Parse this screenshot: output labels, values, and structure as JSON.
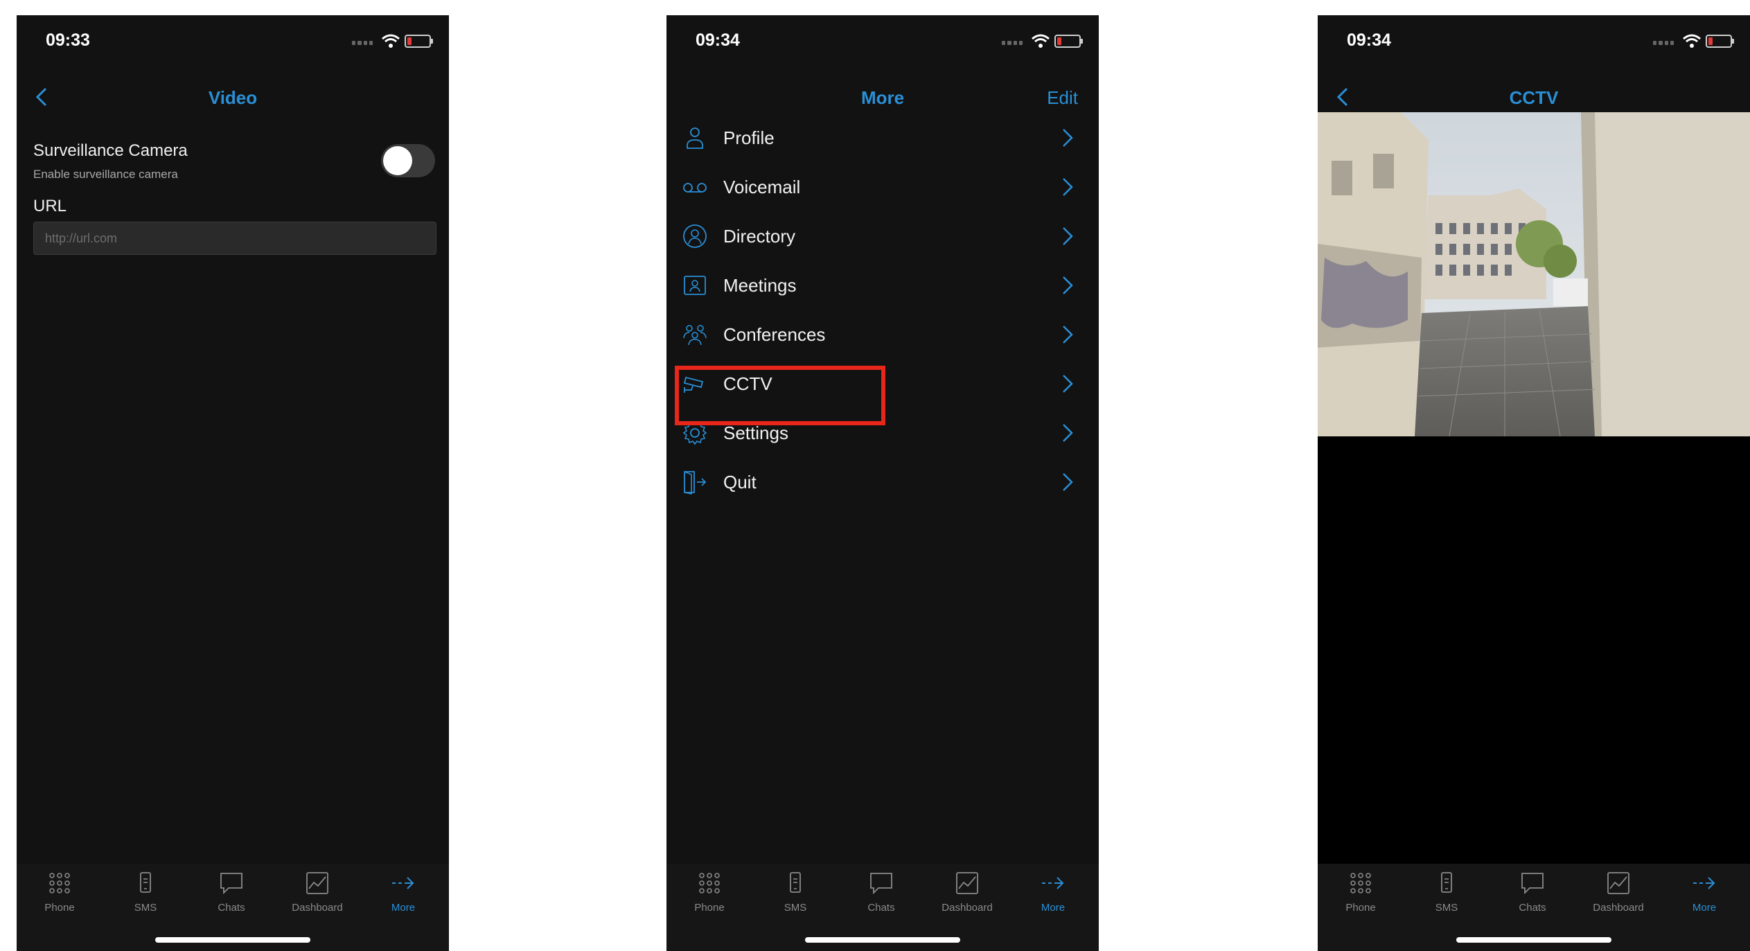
{
  "colors": {
    "accent": "#2a8fd6",
    "background": "#121212",
    "highlight": "#e8261a",
    "battery_low": "#e23a3a"
  },
  "screens": [
    {
      "time": "09:33",
      "title": "Video",
      "setting": {
        "title": "Surveillance Camera",
        "subtitle": "Enable surveillance camera",
        "enabled": false
      },
      "url": {
        "label": "URL",
        "placeholder": "http://url.com",
        "value": ""
      }
    },
    {
      "time": "09:34",
      "title": "More",
      "edit": "Edit",
      "menu": [
        {
          "label": "Profile",
          "icon": "person-icon"
        },
        {
          "label": "Voicemail",
          "icon": "voicemail-icon"
        },
        {
          "label": "Directory",
          "icon": "directory-icon"
        },
        {
          "label": "Meetings",
          "icon": "meetings-icon"
        },
        {
          "label": "Conferences",
          "icon": "conferences-icon"
        },
        {
          "label": "CCTV",
          "icon": "cctv-icon",
          "highlighted": true
        },
        {
          "label": "Settings",
          "icon": "gear-icon"
        },
        {
          "label": "Quit",
          "icon": "quit-icon"
        }
      ]
    },
    {
      "time": "09:34",
      "title": "CCTV"
    }
  ],
  "tabbar": [
    {
      "label": "Phone",
      "icon": "keypad-icon"
    },
    {
      "label": "SMS",
      "icon": "sms-icon"
    },
    {
      "label": "Chats",
      "icon": "chat-bubble-icon"
    },
    {
      "label": "Dashboard",
      "icon": "dashboard-icon"
    },
    {
      "label": "More",
      "icon": "more-arrow-icon",
      "active": true
    }
  ]
}
